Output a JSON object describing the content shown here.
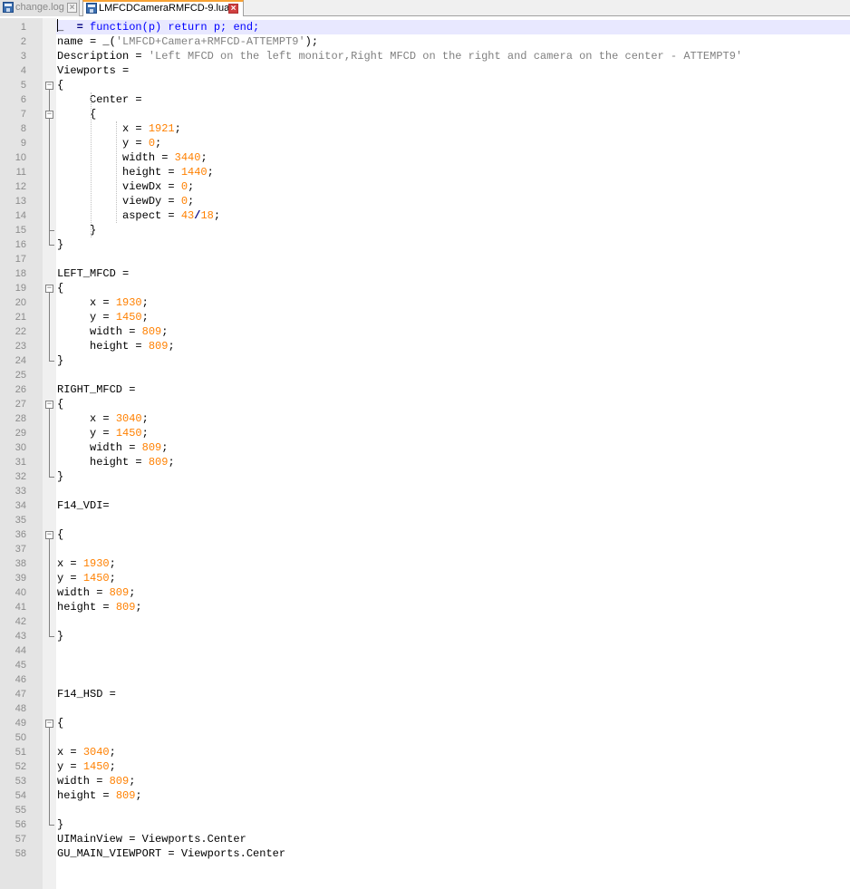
{
  "tabs": [
    {
      "label": "change.log",
      "active": false,
      "icon": "save-disk-icon"
    },
    {
      "label": "LMFCDCameraRMFCD-9.lua",
      "active": true,
      "icon": "save-disk-icon"
    }
  ],
  "colors": {
    "keyword": "#0000ff",
    "string": "#808080",
    "number": "#ff8000",
    "current_line": "#e8e8ff",
    "active_tab_accent": "#f7a234"
  },
  "editor": {
    "current_line": 1,
    "lines": [
      [
        [
          "_  ",
          "t"
        ],
        [
          "= ",
          "o"
        ],
        [
          "function(p) return p; end;",
          "k"
        ]
      ],
      [
        [
          "name = _(",
          "t"
        ],
        [
          "'LMFCD+Camera+RMFCD-ATTEMPT9'",
          "s"
        ],
        [
          ");",
          "t"
        ]
      ],
      [
        [
          "Description = ",
          "t"
        ],
        [
          "'Left MFCD on the left monitor,Right MFCD on the right and camera on the center - ATTEMPT9'",
          "s"
        ]
      ],
      [
        [
          "Viewports =",
          "t"
        ]
      ],
      [
        [
          "{",
          "t"
        ]
      ],
      [
        [
          "     Center =",
          "t"
        ]
      ],
      [
        [
          "     {",
          "t"
        ]
      ],
      [
        [
          "          x = ",
          "t"
        ],
        [
          "1921",
          "n"
        ],
        [
          ";",
          "t"
        ]
      ],
      [
        [
          "          y = ",
          "t"
        ],
        [
          "0",
          "n"
        ],
        [
          ";",
          "t"
        ]
      ],
      [
        [
          "          width = ",
          "t"
        ],
        [
          "3440",
          "n"
        ],
        [
          ";",
          "t"
        ]
      ],
      [
        [
          "          height = ",
          "t"
        ],
        [
          "1440",
          "n"
        ],
        [
          ";",
          "t"
        ]
      ],
      [
        [
          "          viewDx = ",
          "t"
        ],
        [
          "0",
          "n"
        ],
        [
          ";",
          "t"
        ]
      ],
      [
        [
          "          viewDy = ",
          "t"
        ],
        [
          "0",
          "n"
        ],
        [
          ";",
          "t"
        ]
      ],
      [
        [
          "          aspect = ",
          "t"
        ],
        [
          "43",
          "n"
        ],
        [
          "/",
          "o"
        ],
        [
          "18",
          "n"
        ],
        [
          ";",
          "t"
        ]
      ],
      [
        [
          "     }",
          "t"
        ]
      ],
      [
        [
          "}",
          "t"
        ]
      ],
      [
        [
          "",
          "t"
        ]
      ],
      [
        [
          "LEFT_MFCD =",
          "t"
        ]
      ],
      [
        [
          "{",
          "t"
        ]
      ],
      [
        [
          "     x = ",
          "t"
        ],
        [
          "1930",
          "n"
        ],
        [
          ";",
          "t"
        ]
      ],
      [
        [
          "     y = ",
          "t"
        ],
        [
          "1450",
          "n"
        ],
        [
          ";",
          "t"
        ]
      ],
      [
        [
          "     width = ",
          "t"
        ],
        [
          "809",
          "n"
        ],
        [
          ";",
          "t"
        ]
      ],
      [
        [
          "     height = ",
          "t"
        ],
        [
          "809",
          "n"
        ],
        [
          ";",
          "t"
        ]
      ],
      [
        [
          "}",
          "t"
        ]
      ],
      [
        [
          "",
          "t"
        ]
      ],
      [
        [
          "RIGHT_MFCD =",
          "t"
        ]
      ],
      [
        [
          "{",
          "t"
        ]
      ],
      [
        [
          "     x = ",
          "t"
        ],
        [
          "3040",
          "n"
        ],
        [
          ";",
          "t"
        ]
      ],
      [
        [
          "     y = ",
          "t"
        ],
        [
          "1450",
          "n"
        ],
        [
          ";",
          "t"
        ]
      ],
      [
        [
          "     width = ",
          "t"
        ],
        [
          "809",
          "n"
        ],
        [
          ";",
          "t"
        ]
      ],
      [
        [
          "     height = ",
          "t"
        ],
        [
          "809",
          "n"
        ],
        [
          ";",
          "t"
        ]
      ],
      [
        [
          "}",
          "t"
        ]
      ],
      [
        [
          "",
          "t"
        ]
      ],
      [
        [
          "F14_VDI=",
          "t"
        ]
      ],
      [
        [
          "",
          "t"
        ]
      ],
      [
        [
          "{",
          "t"
        ]
      ],
      [
        [
          "",
          "t"
        ]
      ],
      [
        [
          "x = ",
          "t"
        ],
        [
          "1930",
          "n"
        ],
        [
          ";",
          "t"
        ]
      ],
      [
        [
          "y = ",
          "t"
        ],
        [
          "1450",
          "n"
        ],
        [
          ";",
          "t"
        ]
      ],
      [
        [
          "width = ",
          "t"
        ],
        [
          "809",
          "n"
        ],
        [
          ";",
          "t"
        ]
      ],
      [
        [
          "height = ",
          "t"
        ],
        [
          "809",
          "n"
        ],
        [
          ";",
          "t"
        ]
      ],
      [
        [
          "",
          "t"
        ]
      ],
      [
        [
          "}",
          "t"
        ]
      ],
      [
        [
          "",
          "t"
        ]
      ],
      [
        [
          "",
          "t"
        ]
      ],
      [
        [
          "",
          "t"
        ]
      ],
      [
        [
          "F14_HSD =",
          "t"
        ]
      ],
      [
        [
          "",
          "t"
        ]
      ],
      [
        [
          "{",
          "t"
        ]
      ],
      [
        [
          "",
          "t"
        ]
      ],
      [
        [
          "x = ",
          "t"
        ],
        [
          "3040",
          "n"
        ],
        [
          ";",
          "t"
        ]
      ],
      [
        [
          "y = ",
          "t"
        ],
        [
          "1450",
          "n"
        ],
        [
          ";",
          "t"
        ]
      ],
      [
        [
          "width = ",
          "t"
        ],
        [
          "809",
          "n"
        ],
        [
          ";",
          "t"
        ]
      ],
      [
        [
          "height = ",
          "t"
        ],
        [
          "809",
          "n"
        ],
        [
          ";",
          "t"
        ]
      ],
      [
        [
          "",
          "t"
        ]
      ],
      [
        [
          "}",
          "t"
        ]
      ],
      [
        [
          "UIMainView = Viewports.Center",
          "t"
        ]
      ],
      [
        [
          "GU_MAIN_VIEWPORT = Viewports.Center",
          "t"
        ]
      ]
    ],
    "fold_blocks": [
      [
        5,
        16
      ],
      [
        7,
        15
      ],
      [
        19,
        24
      ],
      [
        27,
        32
      ],
      [
        36,
        43
      ],
      [
        49,
        56
      ]
    ]
  }
}
